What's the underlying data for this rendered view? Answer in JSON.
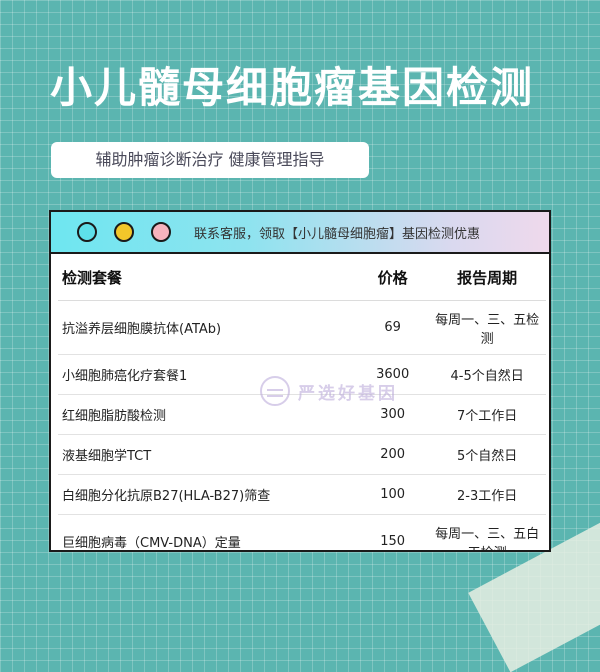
{
  "title": "小儿髓母细胞瘤基因检测",
  "subtitle": "辅助肿瘤诊断治疗 健康管理指导",
  "card": {
    "notice": "联系客服，领取【小儿髓母细胞瘤】基因检测优惠",
    "headers": {
      "name": "检测套餐",
      "price": "价格",
      "period": "报告周期"
    },
    "rows": [
      {
        "name": "抗溢养层细胞膜抗体(ATAb)",
        "price": "69",
        "period": "每周一、三、五检测"
      },
      {
        "name": "小细胞肺癌化疗套餐1",
        "price": "3600",
        "period": "4-5个自然日"
      },
      {
        "name": "红细胞脂肪酸检测",
        "price": "300",
        "period": "7个工作日"
      },
      {
        "name": "液基细胞学TCT",
        "price": "200",
        "period": "5个自然日"
      },
      {
        "name": "白细胞分化抗原B27(HLA-B27)筛查",
        "price": "100",
        "period": "2-3工作日"
      },
      {
        "name": "巨细胞病毒（CMV-DNA）定量",
        "price": "150",
        "period": "每周一、三、五白天检测"
      }
    ]
  },
  "watermark": "严选好基因",
  "colors": {
    "background": "#5bb5b0",
    "dot_cyan": "#5ee0ea",
    "dot_yellow": "#f3c72a",
    "dot_pink": "#f6b3bd"
  }
}
